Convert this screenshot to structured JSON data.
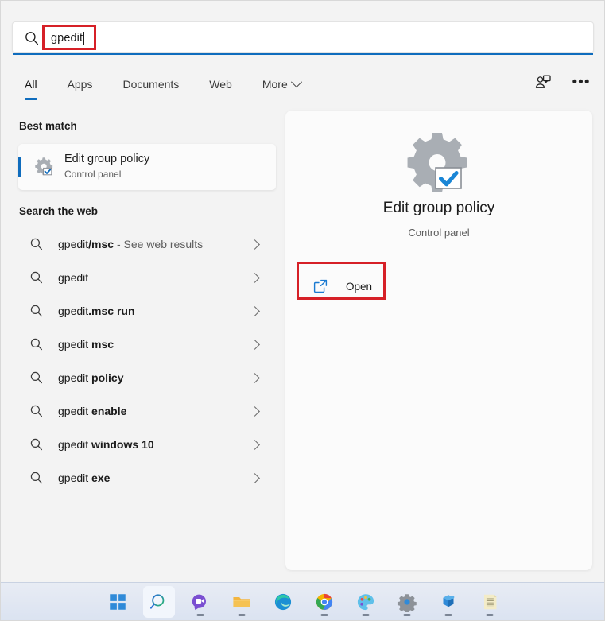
{
  "search": {
    "value": "gpedit",
    "icon": "search-icon",
    "caret_visible": true
  },
  "tabs": [
    {
      "label": "All",
      "active": true
    },
    {
      "label": "Apps",
      "active": false
    },
    {
      "label": "Documents",
      "active": false
    },
    {
      "label": "Web",
      "active": false
    },
    {
      "label": "More",
      "active": false,
      "has_chevron": true
    }
  ],
  "header_icons": [
    {
      "name": "feedback-icon",
      "label": ""
    },
    {
      "name": "more-options-icon",
      "label": "•••"
    }
  ],
  "left": {
    "best_match_title": "Best match",
    "best_match": {
      "title": "Edit group policy",
      "subtitle": "Control panel",
      "icon": "gear-checkbox-icon"
    },
    "web_title": "Search the web",
    "web_results": [
      {
        "prefix": "gpedit",
        "bold": "/msc",
        "suffix": " - See web results"
      },
      {
        "prefix": "gpedit",
        "bold": "",
        "suffix": ""
      },
      {
        "prefix": "gpedit",
        "bold": ".msc run",
        "suffix": ""
      },
      {
        "prefix": "gpedit ",
        "bold": "msc",
        "suffix": ""
      },
      {
        "prefix": "gpedit ",
        "bold": "policy",
        "suffix": ""
      },
      {
        "prefix": "gpedit ",
        "bold": "enable",
        "suffix": ""
      },
      {
        "prefix": "gpedit ",
        "bold": "windows 10",
        "suffix": ""
      },
      {
        "prefix": "gpedit ",
        "bold": "exe",
        "suffix": ""
      }
    ]
  },
  "preview": {
    "title": "Edit group policy",
    "subtitle": "Control panel",
    "icon": "gear-checkbox-icon",
    "open_label": "Open",
    "open_icon": "external-link-icon"
  },
  "annotations": {
    "query_box_color": "#d62027",
    "open_box_color": "#d62027"
  },
  "taskbar": {
    "items": [
      {
        "name": "start-button",
        "label": "Start",
        "active": false,
        "running": false
      },
      {
        "name": "search-button",
        "label": "Search",
        "active": true,
        "running": false
      },
      {
        "name": "chat-button",
        "label": "Chat",
        "active": false,
        "running": true
      },
      {
        "name": "file-explorer-button",
        "label": "File Explorer",
        "active": false,
        "running": true
      },
      {
        "name": "edge-button",
        "label": "Microsoft Edge",
        "active": false,
        "running": false
      },
      {
        "name": "chrome-button",
        "label": "Google Chrome",
        "active": false,
        "running": true
      },
      {
        "name": "paint-button",
        "label": "Paint",
        "active": false,
        "running": true
      },
      {
        "name": "settings-button",
        "label": "Settings",
        "active": false,
        "running": true
      },
      {
        "name": "store-button",
        "label": "Microsoft Store",
        "active": false,
        "running": true
      },
      {
        "name": "notepad-button",
        "label": "Notepad",
        "active": false,
        "running": true
      }
    ]
  },
  "colors": {
    "accent_blue": "#0f6cbd",
    "annotation_red": "#d62027",
    "body_bg": "#f3f3f3",
    "panel_bg": "#fbfbfb"
  }
}
